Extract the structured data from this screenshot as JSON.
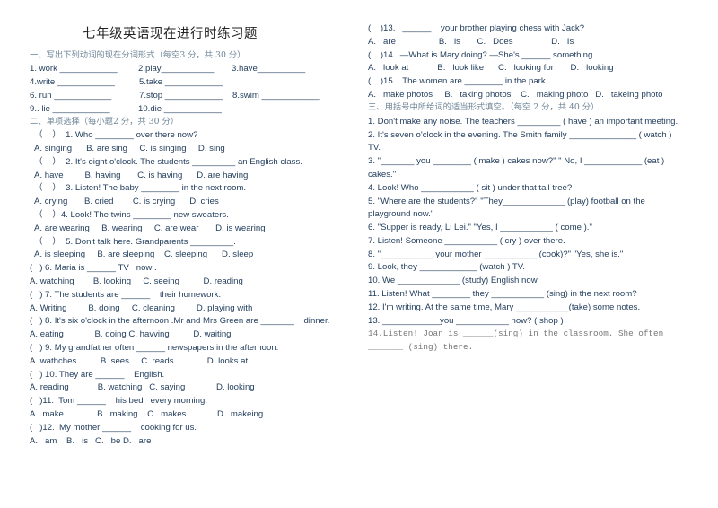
{
  "title": "七年级英语现在进行时练习题",
  "left": {
    "section1_header": "一、写出下列动词的现在分词形式（每空3 分，共 30 分）",
    "verbs_rows": [
      [
        "1. work ____________",
        "2.play___________",
        "3.have__________"
      ],
      [
        "4.write ____________",
        "5.take ____________",
        ""
      ],
      [
        "6. run ____________",
        "7.stop ____________",
        "8.swim ____________"
      ],
      [
        "9.. lie ____________",
        "10.die ____________",
        ""
      ]
    ],
    "section2_header": "二、单项选择（每小题2 分，共 30 分）",
    "lines": [
      "（    ）  1. Who ________ over there now?",
      "A. singing      B. are sing     C. is singing     D. sing",
      "（    ）  2. It's eight o'clock. The students _________ an English class.",
      "A. have         B. having       C. is having      D. are having",
      "（    ）  3. Listen! The baby ________ in the next room.",
      "A. crying       B. cried        C. is crying      D. cries",
      "（    ）4. Look! The twins ________ new sweaters.",
      "A. are wearing     B. wearing     C. are wear       D. is wearing",
      "（    ）  5. Don't talk here. Grandparents _________.",
      "A. is sleeping     B. are sleeping    C. sleeping      D. sleep",
      "(   ) 6. Maria is ______ TV   now .",
      "A. watching        B. looking     C. seeing          D. reading",
      "(   ) 7. The students are ______    their homework.",
      "A. Writing         B. doing     C. cleaning         D. playing with",
      "(   ) 8. It's six o'clock in the afternoon .Mr and Mrs Green are _______    dinner.",
      "A. eating             B. doing C. havving          D. waiting",
      "(   ) 9. My grandfather often ______ newspapers in the afternoon.",
      "A. wathches          B. sees     C. reads              D. looks at",
      "(   ) 10. They are ______    English.",
      "A. reading            B. watching   C. saying             D. looking",
      "(   )11.  Tom ______    his bed   every morning.",
      "A.  make              B.  making    C.  makes             D.  makeing",
      "(   )12.  My mother ______    cooking for us.",
      "A.   am    B.   is   C.   be D.   are"
    ]
  },
  "right": {
    "lines_mc": [
      "(    )13.   ______    your brother playing chess with Jack?",
      "A.   are                  B.   is       C.   Does                D.   Is",
      "(    )14.  —What is Mary doing? —She's ______ something.",
      "A.   look at            B.   look like      C.   looking for       D.   looking",
      "(    )15.   The women are ________ in the park.",
      "A.   make photos     B.   taking photos    C.   making photo   D.   takeing photo"
    ],
    "section3_header": "三、用括号中所给词的适当形式填空。（每空 2 分，共 40 分）",
    "lines_fill": [
      "1. Don't make any noise. The teachers _________ ( have ) an important meeting.",
      "2. It's seven o'clock in the evening. The Smith family ______________ ( watch )",
      "TV.",
      "3. \"_______ you ________ ( make ) cakes now?\" \" No, I ____________ (eat )",
      "cakes.\"",
      "4. Look! Who ___________ ( sit ) under that tall tree?",
      "5. \"Where are the students?\" \"They_____________ (play) football on the",
      "playground now.\"",
      "6. \"Supper is ready, Li Lei.\" \"Yes, I ___________ ( come ).\"",
      "7. Listen! Someone ___________ ( cry ) over there.",
      "8. \"___________ your mother ___________ (cook)?\" \"Yes, she is.\"",
      "9. Look, they ____________ (watch ) TV.",
      "10. We _____________ (study) English now.",
      "11. Listen! What ________ they ___________ (sing) in the next room?",
      "12. I'm writing. At the same time, Mary ___________(take) some notes.",
      "13. ____________you ___________ now? ( shop )"
    ],
    "lines_mono": [
      "14.Listen! Joan is ______(sing) in the classroom. She often",
      "_______ (sing) there."
    ]
  }
}
